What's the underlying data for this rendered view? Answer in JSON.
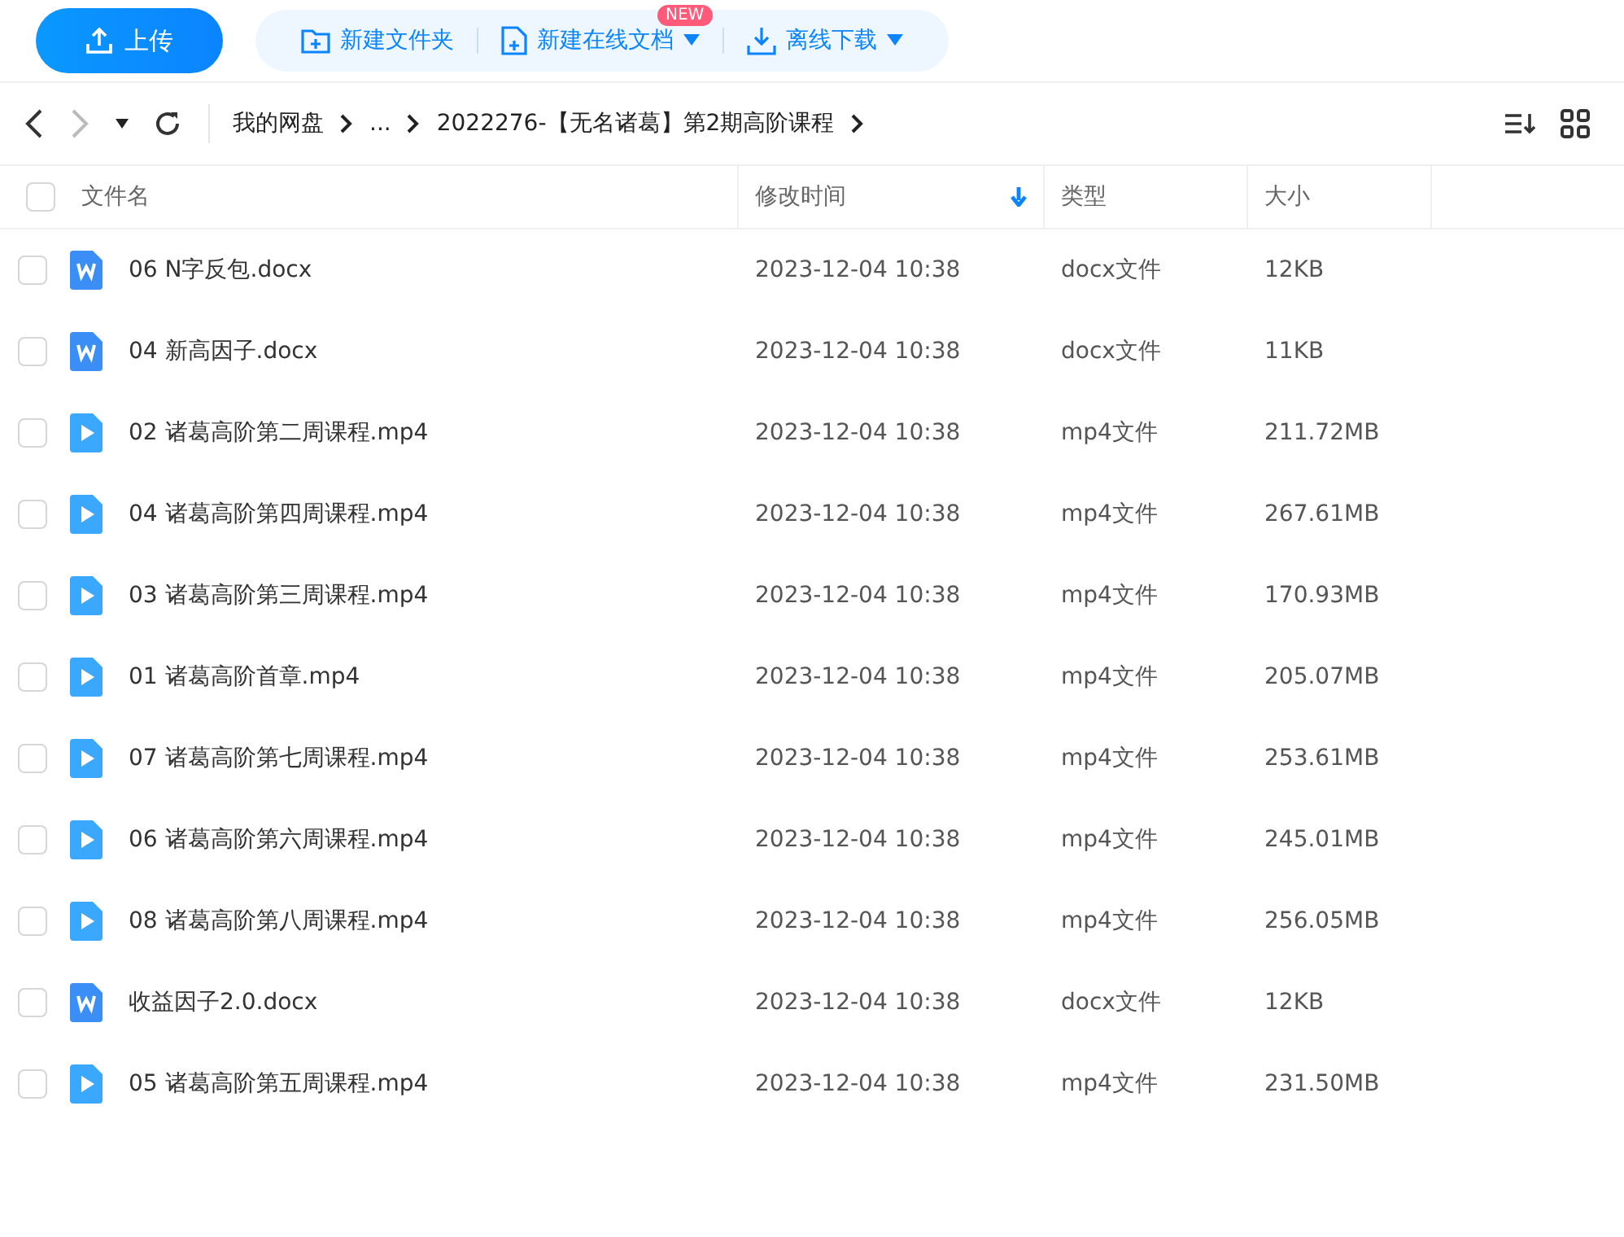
{
  "toolbar": {
    "upload": "上传",
    "actions": [
      {
        "kind": "folder",
        "label": "新建文件夹",
        "dropdown": false
      },
      {
        "kind": "doc",
        "label": "新建在线文档",
        "dropdown": true,
        "badge": "NEW"
      },
      {
        "kind": "download",
        "label": "离线下载",
        "dropdown": true
      }
    ]
  },
  "breadcrumb": {
    "items": [
      "我的网盘",
      "...",
      "2022276-【无名诸葛】第2期高阶课程"
    ]
  },
  "table": {
    "select_all_checked": false,
    "columns": [
      {
        "label": "文件名",
        "sorted": false
      },
      {
        "label": "修改时间",
        "sorted": true
      },
      {
        "label": "类型",
        "sorted": false
      },
      {
        "label": "大小",
        "sorted": false
      }
    ],
    "rows": [
      {
        "kind": "doc",
        "name": "06 N字反包.docx",
        "time": "2023-12-04 10:38",
        "type": "docx文件",
        "size": "12KB",
        "checked": false
      },
      {
        "kind": "doc",
        "name": "04 新高因子.docx",
        "time": "2023-12-04 10:38",
        "type": "docx文件",
        "size": "11KB",
        "checked": false
      },
      {
        "kind": "video",
        "name": "02 诸葛高阶第二周课程.mp4",
        "time": "2023-12-04 10:38",
        "type": "mp4文件",
        "size": "211.72MB",
        "checked": false
      },
      {
        "kind": "video",
        "name": "04 诸葛高阶第四周课程.mp4",
        "time": "2023-12-04 10:38",
        "type": "mp4文件",
        "size": "267.61MB",
        "checked": false
      },
      {
        "kind": "video",
        "name": "03 诸葛高阶第三周课程.mp4",
        "time": "2023-12-04 10:38",
        "type": "mp4文件",
        "size": "170.93MB",
        "checked": false
      },
      {
        "kind": "video",
        "name": "01 诸葛高阶首章.mp4",
        "time": "2023-12-04 10:38",
        "type": "mp4文件",
        "size": "205.07MB",
        "checked": false
      },
      {
        "kind": "video",
        "name": "07 诸葛高阶第七周课程.mp4",
        "time": "2023-12-04 10:38",
        "type": "mp4文件",
        "size": "253.61MB",
        "checked": false
      },
      {
        "kind": "video",
        "name": "06 诸葛高阶第六周课程.mp4",
        "time": "2023-12-04 10:38",
        "type": "mp4文件",
        "size": "245.01MB",
        "checked": false
      },
      {
        "kind": "video",
        "name": "08 诸葛高阶第八周课程.mp4",
        "time": "2023-12-04 10:38",
        "type": "mp4文件",
        "size": "256.05MB",
        "checked": false
      },
      {
        "kind": "doc",
        "name": "收益因子2.0.docx",
        "time": "2023-12-04 10:38",
        "type": "docx文件",
        "size": "12KB",
        "checked": false
      },
      {
        "kind": "video",
        "name": "05 诸葛高阶第五周课程.mp4",
        "time": "2023-12-04 10:38",
        "type": "mp4文件",
        "size": "231.50MB",
        "checked": false
      }
    ]
  }
}
